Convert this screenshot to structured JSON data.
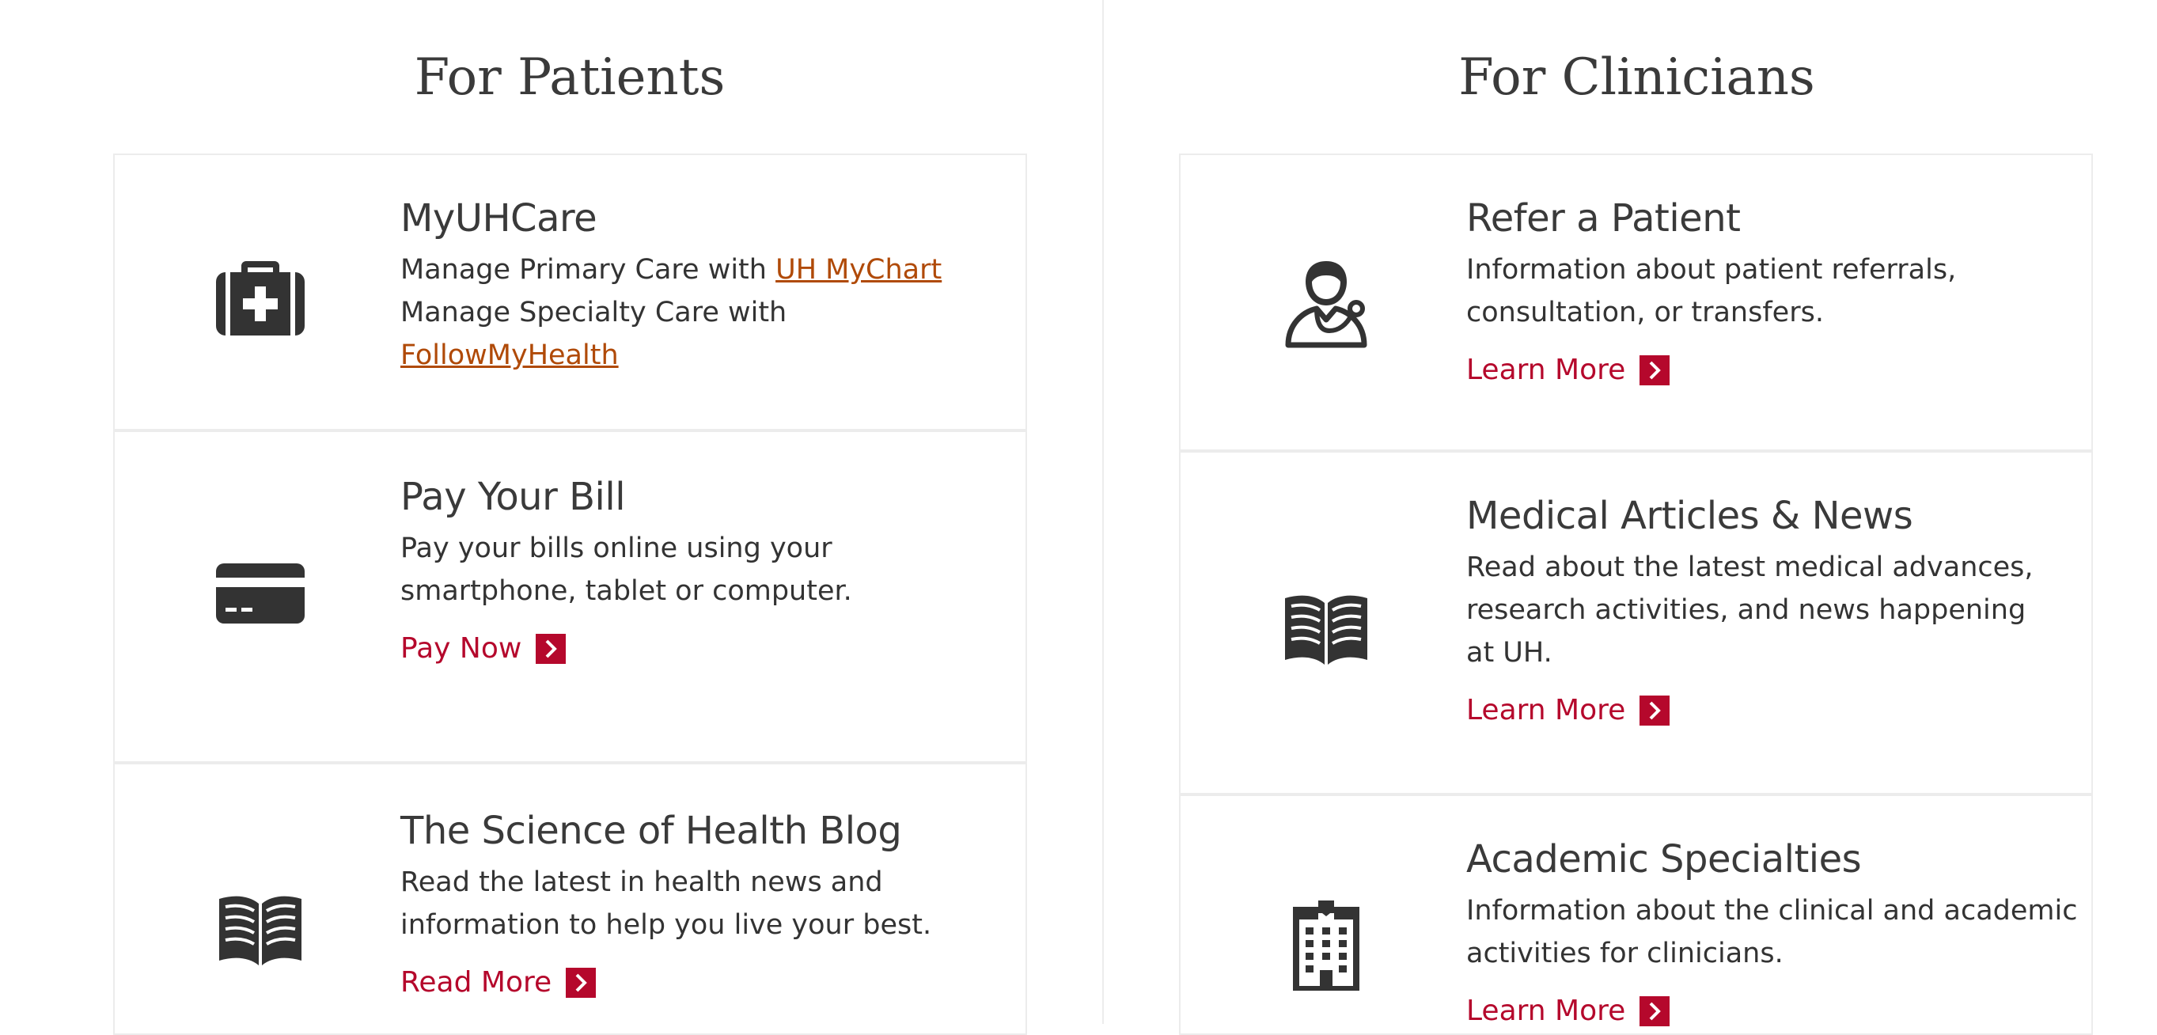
{
  "patients": {
    "heading": "For Patients",
    "cards": [
      {
        "icon": "first-aid-kit-icon",
        "title": "MyUHCare",
        "line1_prefix": "Manage Primary Care with ",
        "line1_link": "UH MyChart",
        "line2_prefix": "Manage Specialty Care with ",
        "line2_link": "FollowMyHealth"
      },
      {
        "icon": "credit-card-icon",
        "title": "Pay Your Bill",
        "text": "Pay your bills online using your smartphone, tablet or computer.",
        "cta": "Pay Now"
      },
      {
        "icon": "open-book-icon",
        "title": "The Science of Health Blog",
        "text": "Read the latest in health news and information to help you live your best.",
        "cta": "Read More"
      }
    ]
  },
  "clinicians": {
    "heading": "For Clinicians",
    "cards": [
      {
        "icon": "doctor-stethoscope-icon",
        "title": "Refer a Patient",
        "text": "Information about patient referrals, consultation, or transfers.",
        "cta": "Learn More"
      },
      {
        "icon": "open-book-icon",
        "title": "Medical Articles & News",
        "text": "Read about the latest medical advances, research activities, and news happening at UH.",
        "cta": "Learn More"
      },
      {
        "icon": "hospital-building-icon",
        "title": "Academic Specialties",
        "text": "Information about the clinical and academic activities for clinicians.",
        "cta": "Learn More"
      }
    ]
  },
  "colors": {
    "accent": "#b5082c",
    "link": "#b04a08",
    "icon": "#333333",
    "border": "#ececec"
  }
}
